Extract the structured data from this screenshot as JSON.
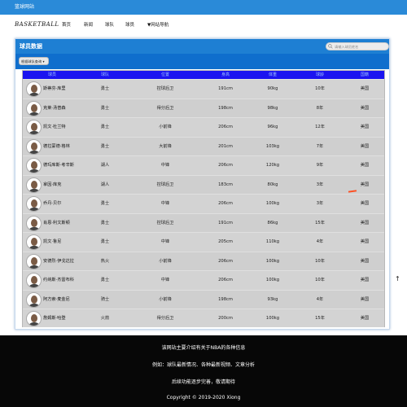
{
  "topbar": {
    "title": "篮球网站"
  },
  "navbar": {
    "logo": "BASKETBALL",
    "items": [
      "首页",
      "新闻",
      "球队",
      "球员",
      "▼网站导航"
    ]
  },
  "panel": {
    "title": "球员数据",
    "search_placeholder": "请输入球员姓名",
    "filter_label": "根据球队查询 ▾"
  },
  "table": {
    "headers": [
      "球员",
      "球队",
      "位置",
      "身高",
      "体重",
      "球龄",
      "国籍"
    ],
    "rows": [
      [
        "斯蒂芬·库里",
        "勇士",
        "控球后卫",
        "191cm",
        "90kg",
        "10年",
        "美国"
      ],
      [
        "克莱·汤普森",
        "勇士",
        "得分后卫",
        "198cm",
        "98kg",
        "8年",
        "美国"
      ],
      [
        "凯文·杜兰特",
        "勇士",
        "小前锋",
        "206cm",
        "96kg",
        "12年",
        "美国"
      ],
      [
        "德拉蒙德·格林",
        "勇士",
        "大前锋",
        "201cm",
        "103kg",
        "7年",
        "美国"
      ],
      [
        "德玛库斯·考辛斯",
        "湖人",
        "中锋",
        "206cm",
        "120kg",
        "9年",
        "美国"
      ],
      [
        "拿因·库克",
        "湖人",
        "控球后卫",
        "183cm",
        "80kg",
        "3年",
        "美国"
      ],
      [
        "乔丹·贝尔",
        "勇士",
        "中锋",
        "206cm",
        "100kg",
        "3年",
        "美国"
      ],
      [
        "肖恩·利文斯顿",
        "勇士",
        "控球后卫",
        "191cm",
        "86kg",
        "15年",
        "美国"
      ],
      [
        "凯文·鲁尼",
        "勇士",
        "中锋",
        "205cm",
        "110kg",
        "4年",
        "美国"
      ],
      [
        "安德烈·伊戈达拉",
        "热火",
        "小前锋",
        "206cm",
        "100kg",
        "10年",
        "美国"
      ],
      [
        "约纳斯·杰雷布科",
        "勇士",
        "中锋",
        "206cm",
        "100kg",
        "10年",
        "美国"
      ],
      [
        "阿方索·麦金尼",
        "骑士",
        "小前锋",
        "198cm",
        "93kg",
        "4年",
        "美国"
      ],
      [
        "詹姆斯·哈登",
        "火箭",
        "得分后卫",
        "200cm",
        "100kg",
        "15年",
        "美国"
      ]
    ]
  },
  "footer": {
    "line1": "该网站主要介绍有关于NBA的各种信息",
    "line2": "例如：球队最新情况、各种最新视频、文章分析",
    "line3": "后续功能逐步完善，敬请期待",
    "line4": "Copyright © 2019-2020 Xiong"
  }
}
